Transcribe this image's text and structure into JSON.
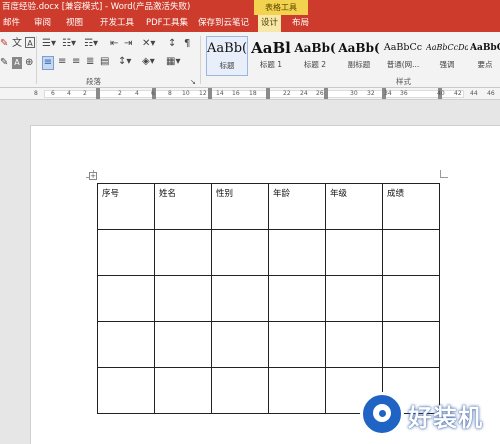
{
  "titlebar": {
    "doc_title": "百度经验.docx [兼容模式] - Word(产品激活失败)",
    "context_tab": "表格工具"
  },
  "tabs": [
    {
      "label": "邮件"
    },
    {
      "label": "审阅"
    },
    {
      "label": "视图"
    },
    {
      "label": "开发工具"
    },
    {
      "label": "PDF工具集"
    },
    {
      "label": "保存到云笔记"
    },
    {
      "label": "设计"
    },
    {
      "label": "布局"
    }
  ],
  "ribbon": {
    "paragraph_group_label": "段落",
    "styles_group_label": "样式",
    "styles": [
      {
        "sample": "AaBb(",
        "name": "标题"
      },
      {
        "sample": "AaBl",
        "name": "标题 1"
      },
      {
        "sample": "AaBb(",
        "name": "标题 2"
      },
      {
        "sample": "AaBb(",
        "name": "副标题"
      },
      {
        "sample": "AaBbCc",
        "name": "普通(网..."
      },
      {
        "sample": "AaBbCcDd",
        "name": "强调"
      },
      {
        "sample": "AaBbCc",
        "name": "要点"
      }
    ]
  },
  "ruler": {
    "ticks": [
      "8",
      "6",
      "4",
      "2",
      "",
      "2",
      "4",
      "6",
      "8",
      "10",
      "12",
      "14",
      "16",
      "18",
      "",
      "22",
      "24",
      "26",
      "",
      "30",
      "32",
      "34",
      "36",
      "",
      "40",
      "42",
      "44",
      "46"
    ]
  },
  "table": {
    "headers": [
      "序号",
      "姓名",
      "性别",
      "年龄",
      "年级",
      "成绩"
    ],
    "rows": [
      [
        "",
        "",
        "",
        "",
        "",
        ""
      ],
      [
        "",
        "",
        "",
        "",
        "",
        ""
      ],
      [
        "",
        "",
        "",
        "",
        "",
        ""
      ],
      [
        "",
        "",
        "",
        "",
        "",
        ""
      ]
    ]
  },
  "watermark": {
    "text": "好装机"
  },
  "colors": {
    "title_bar": "#cd3b2c",
    "context_tab": "#f2d24e",
    "watermark_blue": "#1f63c4"
  }
}
